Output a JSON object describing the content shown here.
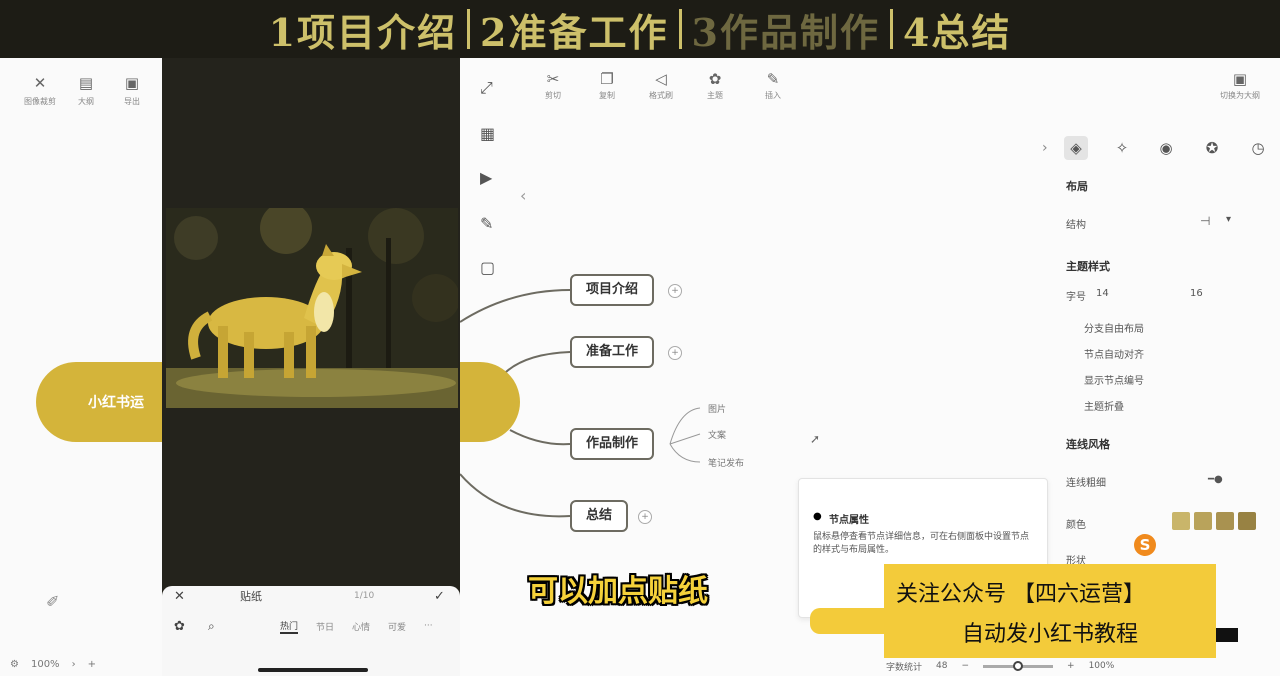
{
  "banner": {
    "seg1": "1项目介绍",
    "seg2": "2准备工作",
    "seg3": "3作品制作",
    "seg4": "4总结"
  },
  "left_panel": {
    "tools": [
      {
        "icon": "crop-icon",
        "glyph": "✕",
        "label": "图像裁剪"
      },
      {
        "icon": "layout-icon",
        "glyph": "▤",
        "label": "大纲"
      },
      {
        "icon": "export-icon",
        "glyph": "▣",
        "label": "导出"
      }
    ],
    "pill_text": "小红书运",
    "status_zoom": "100%"
  },
  "phone": {
    "sheet_title": "贴纸",
    "sheet_count": "1/10",
    "bottom_tools": [
      {
        "icon": "sticker-icon",
        "label": ""
      },
      {
        "icon": "search-icon",
        "label": ""
      },
      {
        "icon": "emoji-tab-icon",
        "label": "热门"
      },
      {
        "icon": "tab-icon",
        "label": "节日"
      },
      {
        "icon": "tab-icon",
        "label": "心情"
      },
      {
        "icon": "tab-icon",
        "label": "可爱"
      },
      {
        "icon": "more-icon",
        "label": "···"
      }
    ]
  },
  "toolbar": {
    "items": [
      {
        "icon": "cut-icon",
        "glyph": "✂",
        "label": "剪切"
      },
      {
        "icon": "copy-icon",
        "glyph": "❐",
        "label": "复制"
      },
      {
        "icon": "send-icon",
        "glyph": "◁",
        "label": "格式刷"
      },
      {
        "icon": "theme-icon",
        "glyph": "✿",
        "label": "主题"
      },
      {
        "icon": "insert-icon",
        "glyph": "✎",
        "label": "插入"
      }
    ],
    "right": {
      "icon": "outline-icon",
      "label": "切换为大纲"
    }
  },
  "mindmap": {
    "nodes": [
      "项目介绍",
      "准备工作",
      "作品制作",
      "总结"
    ],
    "subs": [
      "图片",
      "文案",
      "笔记发布"
    ]
  },
  "tooltip": {
    "title": "节点属性",
    "body": "鼠标悬停查看节点详细信息，可在右侧面板中设置节点的样式与布局属性。"
  },
  "props": {
    "section1": "布局",
    "row1": "结构",
    "section2": "主题样式",
    "font_size_label": "字号",
    "font_size": "14",
    "font_size2": "16",
    "options": [
      "分支自由布局",
      "节点自动对齐",
      "显示节点编号",
      "主题折叠"
    ],
    "section3": "连线风格",
    "line_label": "连线粗细",
    "color_label": "颜色",
    "shape_label": "形状",
    "swatch_colors": [
      "#c9b56a",
      "#b9a35b",
      "#a99250",
      "#988243"
    ]
  },
  "status": {
    "word_count": "字数统计",
    "count": "48",
    "zoom": "100%"
  },
  "subtitle": "可以加点贴纸",
  "promo": {
    "line1": "关注公众号 【四六运营】",
    "line2": "自动发小红书教程"
  }
}
